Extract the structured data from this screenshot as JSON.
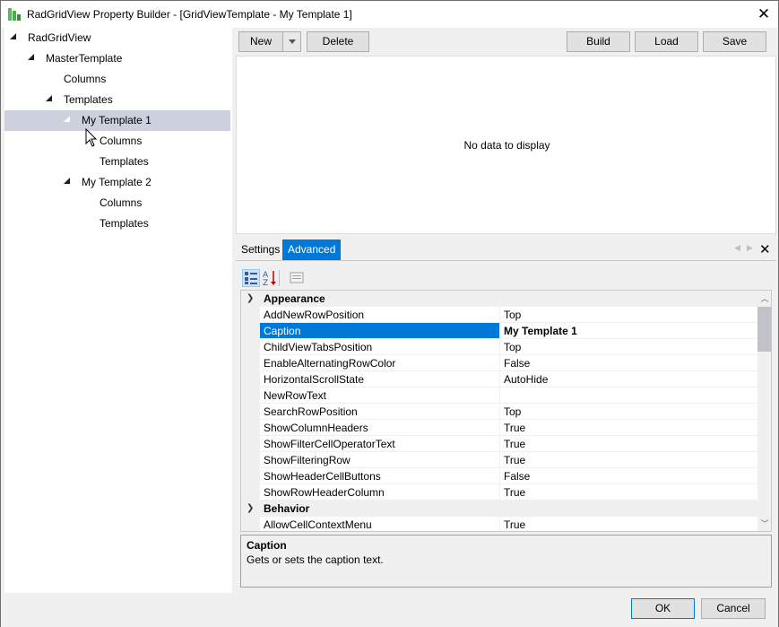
{
  "window": {
    "title": "RadGridView Property Builder - [GridViewTemplate - My Template 1]",
    "close_icon": "close-icon",
    "accent_color": "#0078d7"
  },
  "tree": {
    "items": [
      {
        "label": "RadGridView",
        "expanded": true
      },
      {
        "label": "MasterTemplate",
        "expanded": true
      },
      {
        "label": "Columns"
      },
      {
        "label": "Templates",
        "expanded": true
      },
      {
        "label": "My Template 1",
        "expanded": true,
        "selected": true
      },
      {
        "label": "Columns"
      },
      {
        "label": "Templates"
      },
      {
        "label": "My Template 2",
        "expanded": true
      },
      {
        "label": "Columns"
      },
      {
        "label": "Templates"
      }
    ]
  },
  "toolbar": {
    "new_label": "New",
    "delete_label": "Delete",
    "build_label": "Build",
    "load_label": "Load",
    "save_label": "Save"
  },
  "grid": {
    "empty_text": "No data to display"
  },
  "tabs": [
    {
      "label": "Settings",
      "active": false
    },
    {
      "label": "Advanced",
      "active": true
    }
  ],
  "property_grid": {
    "categories": [
      {
        "name": "Appearance",
        "properties": [
          {
            "name": "AddNewRowPosition",
            "value": "Top"
          },
          {
            "name": "Caption",
            "value": "My Template 1",
            "selected": true
          },
          {
            "name": "ChildViewTabsPosition",
            "value": "Top"
          },
          {
            "name": "EnableAlternatingRowColor",
            "value": "False"
          },
          {
            "name": "HorizontalScrollState",
            "value": "AutoHide"
          },
          {
            "name": "NewRowText",
            "value": ""
          },
          {
            "name": "SearchRowPosition",
            "value": "Top"
          },
          {
            "name": "ShowColumnHeaders",
            "value": "True"
          },
          {
            "name": "ShowFilterCellOperatorText",
            "value": "True"
          },
          {
            "name": "ShowFilteringRow",
            "value": "True"
          },
          {
            "name": "ShowHeaderCellButtons",
            "value": "False"
          },
          {
            "name": "ShowRowHeaderColumn",
            "value": "True"
          }
        ]
      },
      {
        "name": "Behavior",
        "properties": [
          {
            "name": "AllowCellContextMenu",
            "value": "True"
          }
        ]
      }
    ],
    "help": {
      "title": "Caption",
      "description": "Gets or sets the caption text."
    }
  },
  "footer": {
    "ok_label": "OK",
    "cancel_label": "Cancel"
  }
}
